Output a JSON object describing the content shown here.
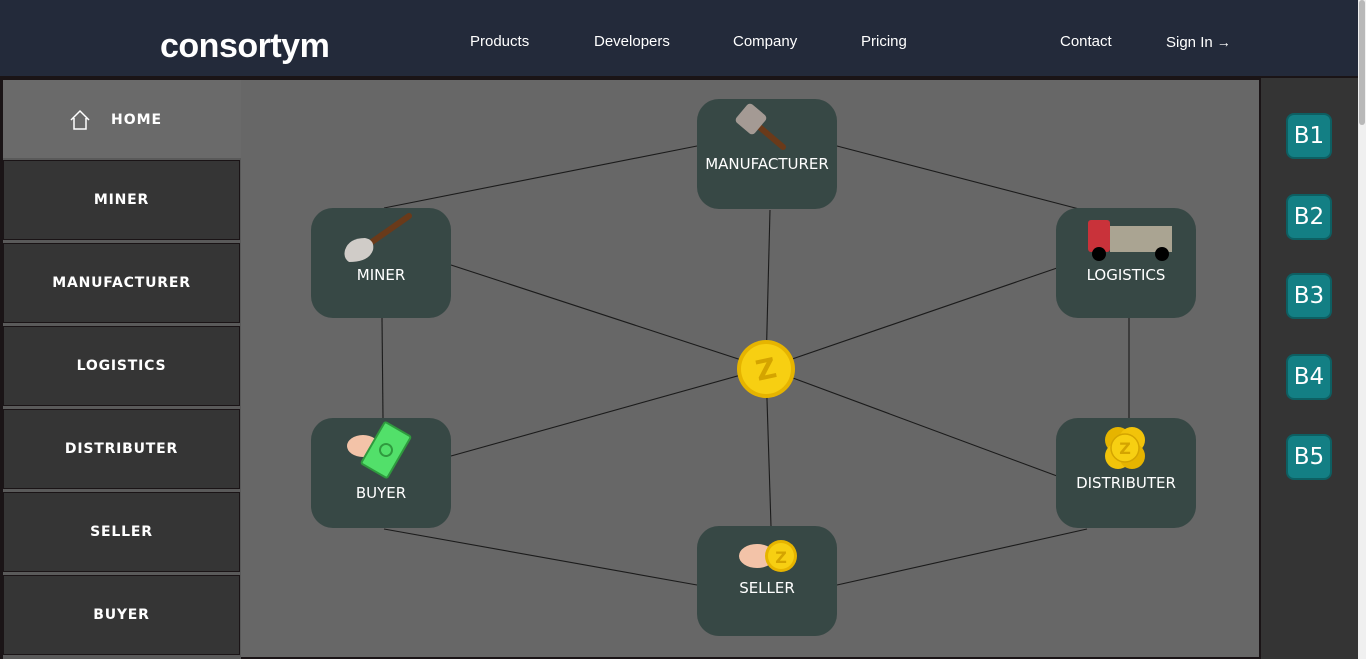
{
  "header": {
    "logo": "consortym",
    "nav": {
      "products": "Products",
      "developers": "Developers",
      "company": "Company",
      "pricing": "Pricing",
      "contact": "Contact",
      "sign_in": "Sign In",
      "sign_in_arrow": "→"
    }
  },
  "sidebar": {
    "home": "HOME",
    "items": [
      "MINER",
      "MANUFACTURER",
      "LOGISTICS",
      "DISTRIBUTER",
      "SELLER",
      "BUYER"
    ]
  },
  "network": {
    "center_icon": "z-coin-icon",
    "nodes": {
      "manufacturer": {
        "label": "MANUFACTURER",
        "icon": "hammer-icon"
      },
      "miner": {
        "label": "MINER",
        "icon": "shovel-icon"
      },
      "logistics": {
        "label": "LOGISTICS",
        "icon": "truck-icon"
      },
      "buyer": {
        "label": "BUYER",
        "icon": "hand-with-cash-icon"
      },
      "distributer": {
        "label": "DISTRIBUTER",
        "icon": "coin-stack-icon"
      },
      "seller": {
        "label": "SELLER",
        "icon": "hand-with-coin-icon"
      }
    },
    "node_color": "#374845",
    "coin_color": "#f2c30a"
  },
  "rightbar": {
    "buttons": [
      "B1",
      "B2",
      "B3",
      "B4",
      "B5"
    ],
    "button_color": "#137f84"
  }
}
